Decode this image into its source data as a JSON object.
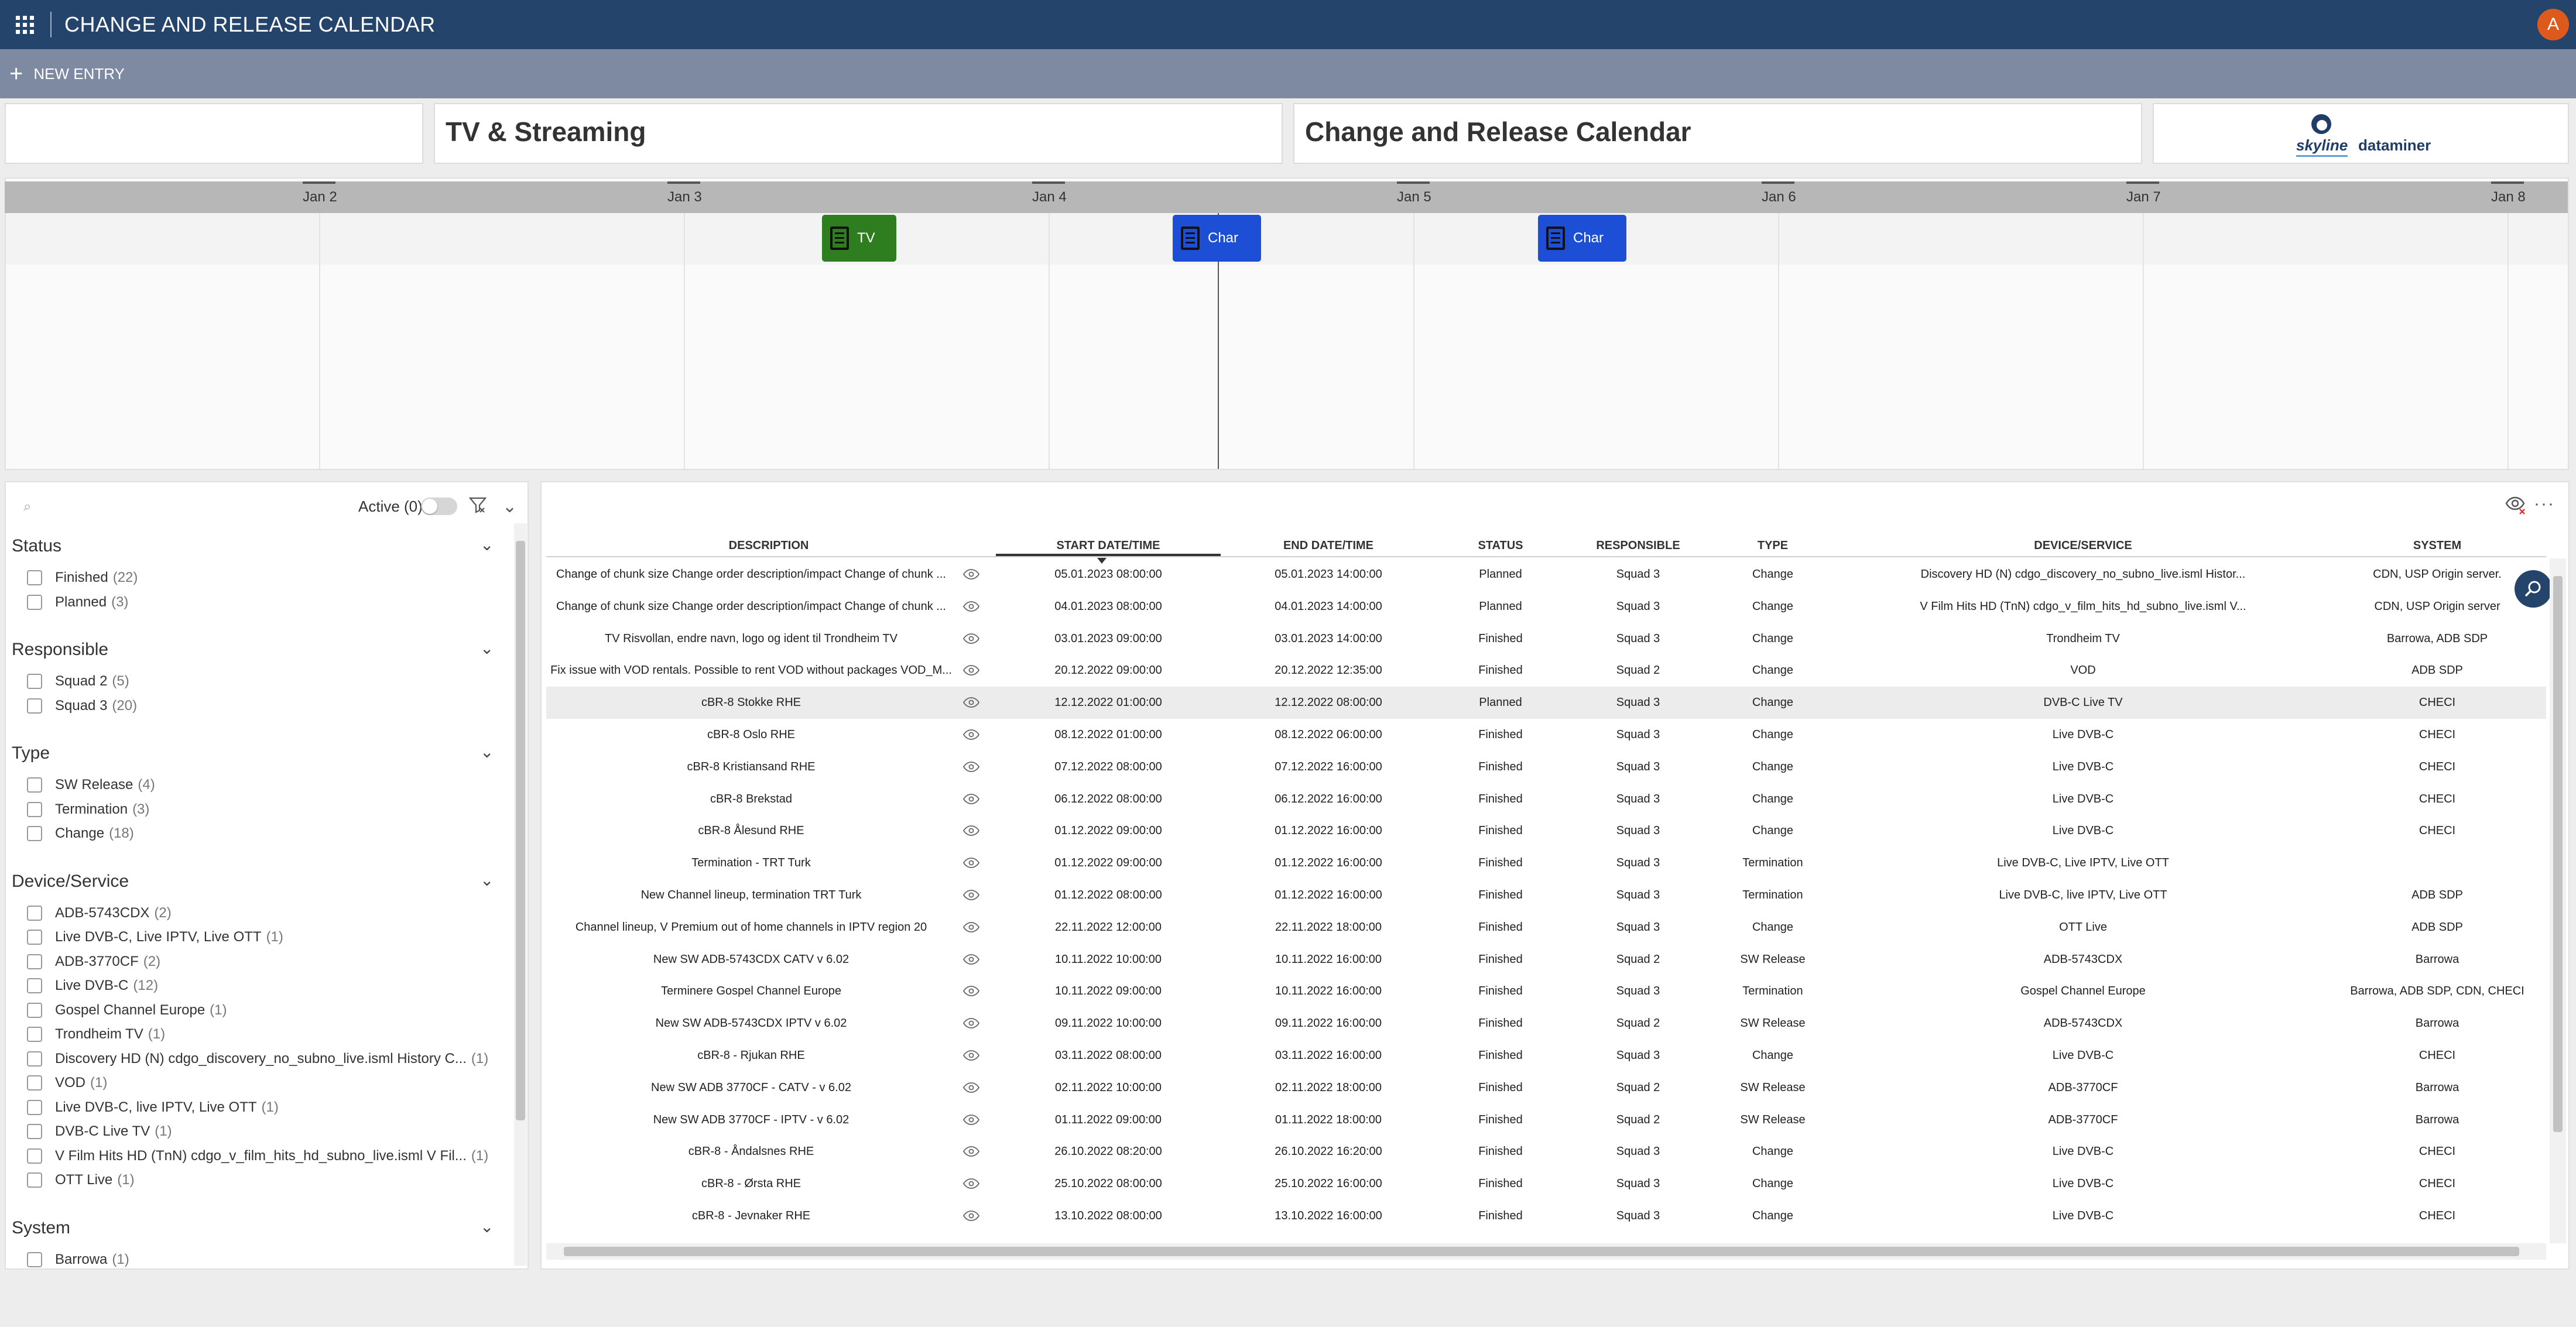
{
  "app": {
    "title": "CHANGE AND RELEASE CALENDAR",
    "avatar_initial": "A",
    "accent": "#24446b",
    "toolbar_color": "#7d8aa1"
  },
  "toolbar": {
    "new_entry_label": "NEW ENTRY"
  },
  "header_cards": {
    "tv_title": "TV & Streaming",
    "calendar_title": "Change and Release Calendar",
    "logo_skyline": "skyline",
    "logo_dataminer": "dataminer"
  },
  "timeline": {
    "dates": [
      "Jan 2",
      "Jan 3",
      "Jan 4",
      "Jan 5",
      "Jan 6",
      "Jan 7",
      "Jan 8"
    ],
    "items": [
      {
        "label": "TV",
        "color": "#2e7d1f"
      },
      {
        "label": "Char",
        "color": "#1d4fd6"
      },
      {
        "label": "Char",
        "color": "#1d4fd6"
      }
    ]
  },
  "filters": {
    "active_label": "Active (0)",
    "groups": [
      {
        "title": "Status",
        "items": [
          {
            "label": "Finished",
            "count": "(22)"
          },
          {
            "label": "Planned",
            "count": "(3)"
          }
        ]
      },
      {
        "title": "Responsible",
        "items": [
          {
            "label": "Squad 2",
            "count": "(5)"
          },
          {
            "label": "Squad 3",
            "count": "(20)"
          }
        ]
      },
      {
        "title": "Type",
        "items": [
          {
            "label": "SW Release",
            "count": "(4)"
          },
          {
            "label": "Termination",
            "count": "(3)"
          },
          {
            "label": "Change",
            "count": "(18)"
          }
        ]
      },
      {
        "title": "Device/Service",
        "items": [
          {
            "label": "ADB-5743CDX",
            "count": "(2)"
          },
          {
            "label": "Live DVB-C, Live IPTV, Live OTT",
            "count": "(1)"
          },
          {
            "label": "ADB-3770CF",
            "count": "(2)"
          },
          {
            "label": "Live DVB-C",
            "count": "(12)"
          },
          {
            "label": "Gospel Channel Europe",
            "count": "(1)"
          },
          {
            "label": "Trondheim TV",
            "count": "(1)"
          },
          {
            "label": "Discovery HD (N) cdgo_discovery_no_subno_live.isml History C...",
            "count": "(1)"
          },
          {
            "label": "VOD",
            "count": "(1)"
          },
          {
            "label": "Live DVB-C, live IPTV, Live OTT",
            "count": "(1)"
          },
          {
            "label": "DVB-C Live TV",
            "count": "(1)"
          },
          {
            "label": "V Film Hits HD (TnN) cdgo_v_film_hits_hd_subno_live.isml V Fil...",
            "count": "(1)"
          },
          {
            "label": "OTT Live",
            "count": "(1)"
          }
        ]
      },
      {
        "title": "System",
        "items": [
          {
            "label": "Barrowa",
            "count": "(1)"
          }
        ]
      }
    ]
  },
  "table": {
    "columns": [
      "DESCRIPTION",
      "START DATE/TIME",
      "END DATE/TIME",
      "STATUS",
      "RESPONSIBLE",
      "TYPE",
      "DEVICE/SERVICE",
      "SYSTEM"
    ],
    "rows": [
      [
        "Change of chunk size Change order description/impact Change of chunk ...",
        "05.01.2023 08:00:00",
        "05.01.2023 14:00:00",
        "Planned",
        "Squad 3",
        "Change",
        "Discovery HD (N) cdgo_discovery_no_subno_live.isml Histor...",
        "CDN, USP Origin server."
      ],
      [
        "Change of chunk size Change order description/impact Change of chunk ...",
        "04.01.2023 08:00:00",
        "04.01.2023 14:00:00",
        "Planned",
        "Squad 3",
        "Change",
        "V Film Hits HD (TnN) cdgo_v_film_hits_hd_subno_live.isml V...",
        "CDN, USP Origin server"
      ],
      [
        "TV Risvollan, endre navn, logo og ident til Trondheim TV",
        "03.01.2023 09:00:00",
        "03.01.2023 14:00:00",
        "Finished",
        "Squad 3",
        "Change",
        "Trondheim TV",
        "Barrowa, ADB SDP"
      ],
      [
        "Fix issue with VOD rentals. Possible to rent VOD without packages VOD_M...",
        "20.12.2022 09:00:00",
        "20.12.2022 12:35:00",
        "Finished",
        "Squad 2",
        "Change",
        "VOD",
        "ADB SDP"
      ],
      [
        "cBR-8 Stokke RHE",
        "12.12.2022 01:00:00",
        "12.12.2022 08:00:00",
        "Planned",
        "Squad 3",
        "Change",
        "DVB-C Live TV",
        "CHECI"
      ],
      [
        "cBR-8 Oslo RHE",
        "08.12.2022 01:00:00",
        "08.12.2022 06:00:00",
        "Finished",
        "Squad 3",
        "Change",
        "Live DVB-C",
        "CHECI"
      ],
      [
        "cBR-8 Kristiansand RHE",
        "07.12.2022 08:00:00",
        "07.12.2022 16:00:00",
        "Finished",
        "Squad 3",
        "Change",
        "Live DVB-C",
        "CHECI"
      ],
      [
        "cBR-8 Brekstad",
        "06.12.2022 08:00:00",
        "06.12.2022 16:00:00",
        "Finished",
        "Squad 3",
        "Change",
        "Live DVB-C",
        "CHECI"
      ],
      [
        "cBR-8 Ålesund RHE",
        "01.12.2022 09:00:00",
        "01.12.2022 16:00:00",
        "Finished",
        "Squad 3",
        "Change",
        "Live DVB-C",
        "CHECI"
      ],
      [
        "Termination - TRT Turk",
        "01.12.2022 09:00:00",
        "01.12.2022 16:00:00",
        "Finished",
        "Squad 3",
        "Termination",
        "Live DVB-C, Live IPTV, Live OTT",
        ""
      ],
      [
        "New Channel lineup, termination TRT Turk",
        "01.12.2022 08:00:00",
        "01.12.2022 16:00:00",
        "Finished",
        "Squad 3",
        "Termination",
        "Live DVB-C, live IPTV, Live OTT",
        "ADB SDP"
      ],
      [
        "Channel lineup, V Premium out of home channels in IPTV region 20",
        "22.11.2022 12:00:00",
        "22.11.2022 18:00:00",
        "Finished",
        "Squad 3",
        "Change",
        "OTT Live",
        "ADB SDP"
      ],
      [
        "New SW ADB-5743CDX CATV v 6.02",
        "10.11.2022 10:00:00",
        "10.11.2022 16:00:00",
        "Finished",
        "Squad 2",
        "SW Release",
        "ADB-5743CDX",
        "Barrowa"
      ],
      [
        "Terminere Gospel Channel Europe",
        "10.11.2022 09:00:00",
        "10.11.2022 16:00:00",
        "Finished",
        "Squad 3",
        "Termination",
        "Gospel Channel Europe",
        "Barrowa, ADB SDP, CDN, CHECI"
      ],
      [
        "New SW ADB-5743CDX IPTV v 6.02",
        "09.11.2022 10:00:00",
        "09.11.2022 16:00:00",
        "Finished",
        "Squad 2",
        "SW Release",
        "ADB-5743CDX",
        "Barrowa"
      ],
      [
        "cBR-8 - Rjukan RHE",
        "03.11.2022 08:00:00",
        "03.11.2022 16:00:00",
        "Finished",
        "Squad 3",
        "Change",
        "Live DVB-C",
        "CHECI"
      ],
      [
        "New SW ADB 3770CF - CATV - v 6.02",
        "02.11.2022 10:00:00",
        "02.11.2022 18:00:00",
        "Finished",
        "Squad 2",
        "SW Release",
        "ADB-3770CF",
        "Barrowa"
      ],
      [
        "New SW ADB 3770CF - IPTV - v 6.02",
        "01.11.2022 09:00:00",
        "01.11.2022 18:00:00",
        "Finished",
        "Squad 2",
        "SW Release",
        "ADB-3770CF",
        "Barrowa"
      ],
      [
        "cBR-8 - Åndalsnes RHE",
        "26.10.2022 08:20:00",
        "26.10.2022 16:20:00",
        "Finished",
        "Squad 3",
        "Change",
        "Live DVB-C",
        "CHECI"
      ],
      [
        "cBR-8 - Ørsta RHE",
        "25.10.2022 08:00:00",
        "25.10.2022 16:00:00",
        "Finished",
        "Squad 3",
        "Change",
        "Live DVB-C",
        "CHECI"
      ],
      [
        "cBR-8 - Jevnaker RHE",
        "13.10.2022 08:00:00",
        "13.10.2022 16:00:00",
        "Finished",
        "Squad 3",
        "Change",
        "Live DVB-C",
        "CHECI"
      ]
    ],
    "highlight_row": 4
  }
}
